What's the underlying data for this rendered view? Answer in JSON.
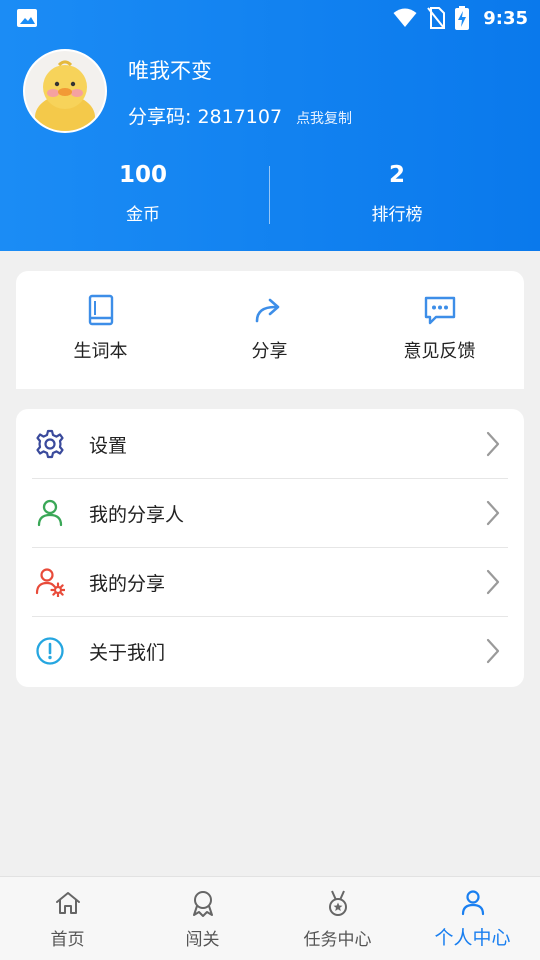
{
  "status_bar": {
    "time": "9:35"
  },
  "profile": {
    "username": "唯我不变",
    "share_code_text": "分享码: 2817107",
    "copy_label": "点我复制"
  },
  "stats": [
    {
      "value": "100",
      "label": "金币"
    },
    {
      "value": "2",
      "label": "排行榜"
    }
  ],
  "quick_actions": [
    {
      "label": "生词本",
      "icon": "book-icon"
    },
    {
      "label": "分享",
      "icon": "share-arrow-icon"
    },
    {
      "label": "意见反馈",
      "icon": "feedback-chat-icon"
    }
  ],
  "menu": [
    {
      "label": "设置",
      "icon": "gear-icon"
    },
    {
      "label": "我的分享人",
      "icon": "person-icon"
    },
    {
      "label": "我的分享",
      "icon": "person-gear-icon"
    },
    {
      "label": "关于我们",
      "icon": "info-icon"
    }
  ],
  "bottom_nav": [
    {
      "label": "首页",
      "icon": "home-icon",
      "active": false
    },
    {
      "label": "闯关",
      "icon": "badge-icon",
      "active": false
    },
    {
      "label": "任务中心",
      "icon": "medal-icon",
      "active": false
    },
    {
      "label": "个人中心",
      "icon": "person-icon",
      "active": true
    }
  ],
  "colors": {
    "header_blue": "#1b8cf5",
    "active_blue": "#1a7ff0",
    "quick_icon": "#3d8ee8",
    "settings_icon": "#3a4a9c",
    "sharer_icon": "#3aa757",
    "myshare_icon": "#e84b3a",
    "about_icon": "#25a6e0"
  }
}
